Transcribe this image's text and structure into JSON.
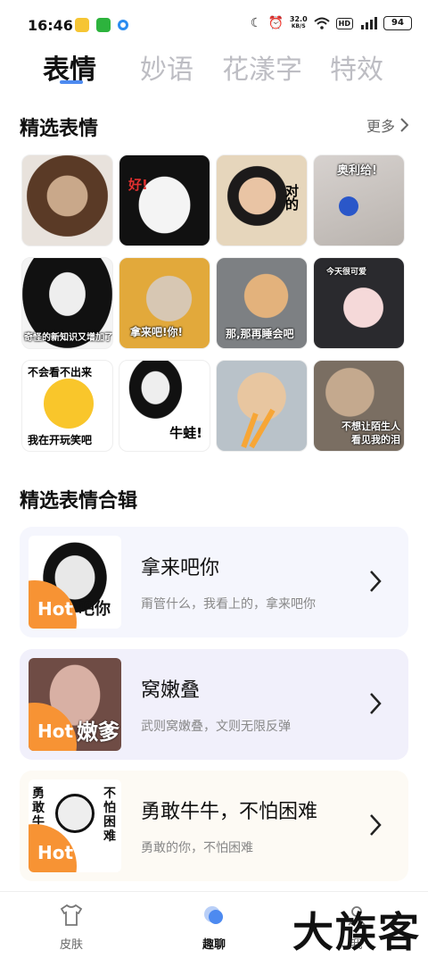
{
  "status_bar": {
    "time": "16:46",
    "net_speed_value": "32.0",
    "net_speed_unit": "KB/S",
    "hd": "HD",
    "battery": "94"
  },
  "tabs": [
    {
      "label": "表情",
      "active": true
    },
    {
      "label": "妙语"
    },
    {
      "label": "花漾字"
    },
    {
      "label": "特效"
    }
  ],
  "featured": {
    "title": "精选表情",
    "more_label": "更多",
    "stickers": [
      {
        "caption": ""
      },
      {
        "caption": "好!"
      },
      {
        "caption": "对的"
      },
      {
        "caption": "奥利给!"
      },
      {
        "caption": "奇怪的新知识又增加了"
      },
      {
        "caption": "拿来吧!你!"
      },
      {
        "caption": "那,那再睡会吧"
      },
      {
        "caption": "今天很可爱"
      },
      {
        "caption": "不会看不出来",
        "caption2": "我在开玩笑吧"
      },
      {
        "caption": "牛蛙!"
      },
      {
        "caption": ""
      },
      {
        "caption": "不想让陌生人",
        "caption2": "看见我的泪"
      }
    ]
  },
  "collections": {
    "title": "精选表情合辑",
    "items": [
      {
        "title": "拿来吧你",
        "subtitle": "甭管什么，我看上的，拿来吧你",
        "badge": "Hot",
        "thumb_text": "吧你"
      },
      {
        "title": "窝嫩叠",
        "subtitle": "武则窝嫩叠，文则无限反弹",
        "badge": "Hot",
        "thumb_text": "嫩爹"
      },
      {
        "title": "勇敢牛牛，不怕困难",
        "subtitle": "勇敢的你，不怕困难",
        "badge": "Hot",
        "thumb_left": "勇敢牛牛",
        "thumb_right": "不怕困难"
      }
    ]
  },
  "bottom_nav": [
    {
      "label": "皮肤"
    },
    {
      "label": "趣聊",
      "active": true
    },
    {
      "label": "我"
    }
  ],
  "watermark": "大族客",
  "colors": {
    "accent": "#4d8af0",
    "hot": "#f79334",
    "card1": "#f5f6fd",
    "card2": "#f1f0fb",
    "card3": "#fdfaf4"
  }
}
